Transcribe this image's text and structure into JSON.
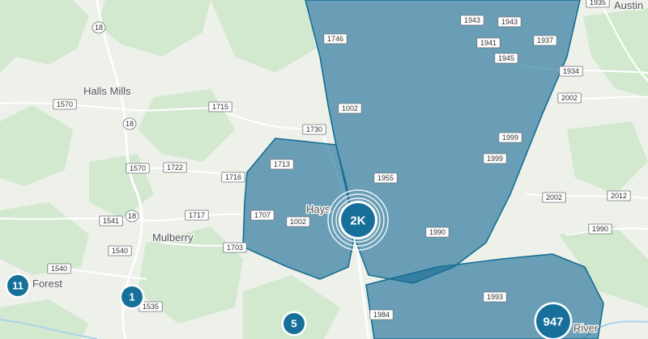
{
  "place_labels": [
    "Halls Mills",
    "Mulberry",
    "Hays",
    "Forest",
    "Austin",
    "River"
  ],
  "route_shields": {
    "rect": [
      "1570",
      "1715",
      "1730",
      "1722",
      "1570",
      "1713",
      "1716",
      "1717",
      "1541",
      "1707",
      "1002",
      "1540",
      "1703",
      "1540",
      "1535",
      "1746",
      "1002",
      "1943",
      "1943",
      "1941",
      "1937",
      "1945",
      "1934",
      "1955",
      "2002",
      "1999",
      "1999",
      "2002",
      "2012",
      "1990",
      "1990",
      "1993",
      "1984",
      "1935"
    ],
    "circle": [
      "18",
      "18",
      "18"
    ]
  },
  "clusters": [
    {
      "label": "2K",
      "size": "large",
      "ringed": true
    },
    {
      "label": "11",
      "size": "small",
      "ringed": false
    },
    {
      "label": "1",
      "size": "small",
      "ringed": false
    },
    {
      "label": "5",
      "size": "small",
      "ringed": false
    },
    {
      "label": "947",
      "size": "large",
      "ringed": false
    }
  ],
  "colors": {
    "land": "#eef0ea",
    "forest": "#cfe8cc",
    "polygon_fill": "#166c96",
    "polygon_stroke": "#176f93",
    "cluster": "#17709a"
  }
}
